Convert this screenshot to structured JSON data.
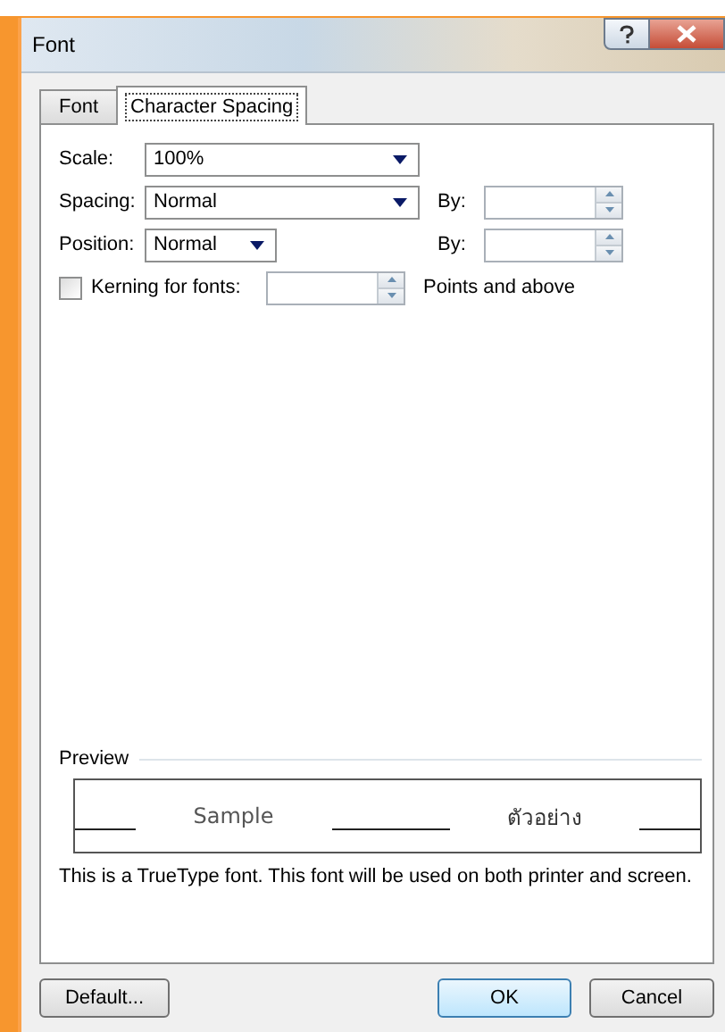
{
  "window": {
    "title": "Font"
  },
  "tabs": [
    {
      "label": "Font",
      "selected": false
    },
    {
      "label": "Character Spacing",
      "selected": true
    }
  ],
  "fields": [
    {
      "label": "Scale:",
      "value": "100%"
    },
    {
      "label": "Spacing:",
      "value": "Normal",
      "by_label": "By:"
    },
    {
      "label": "Position:",
      "value": "Normal",
      "by_label": "By:"
    }
  ],
  "kerning": {
    "label": "Kerning for fonts:",
    "checked": false,
    "suffix": "Points and above"
  },
  "preview": {
    "heading": "Preview",
    "samples": [
      "Sample",
      "ตัวอย่าง"
    ],
    "note": "This is a TrueType font. This font will be used on both printer and screen."
  },
  "buttons": [
    {
      "label": "Default...",
      "kind": "default"
    },
    {
      "label": "OK",
      "kind": "primary"
    },
    {
      "label": "Cancel",
      "kind": "cancel"
    }
  ]
}
